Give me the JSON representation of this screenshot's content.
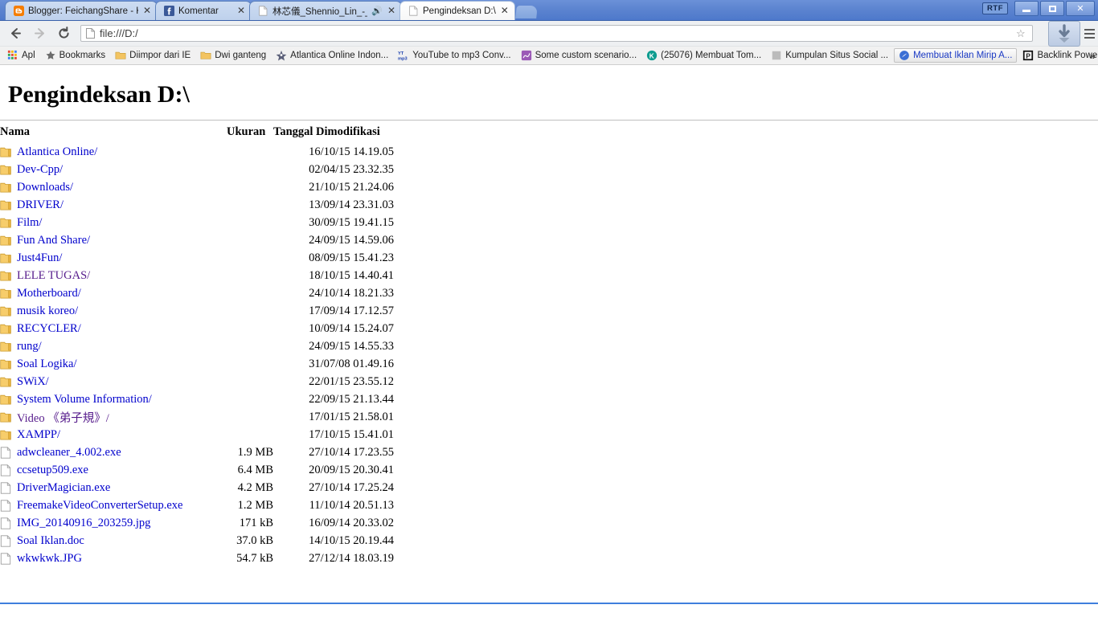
{
  "window": {
    "badge": "RTF",
    "minimize_label": "Minimize",
    "maximize_label": "Maximize",
    "close_label": "Close"
  },
  "tabs": [
    {
      "title": "Blogger: FeichangShare - Kn",
      "icon": "blogger-icon",
      "active": false,
      "audio": false
    },
    {
      "title": "Komentar",
      "icon": "facebook-icon",
      "active": false,
      "audio": false
    },
    {
      "title": "林芯儀_Shennio_Lin_-_",
      "icon": "page-icon",
      "active": false,
      "audio": true
    },
    {
      "title": "Pengindeksan D:\\",
      "icon": "page-icon",
      "active": true,
      "audio": false
    }
  ],
  "newtab_label": "New tab",
  "toolbar": {
    "back_label": "Back",
    "forward_label": "Forward",
    "reload_label": "Reload",
    "url": "file:///D:/",
    "bookmark_star_label": "Bookmark this page",
    "download_label": "Downloads",
    "menu_label": "Customize and control Google Chrome"
  },
  "bookmarks": {
    "overflow_label": "»",
    "items": [
      {
        "label": "Apl",
        "icon": "apps-grid-icon",
        "highlight": false
      },
      {
        "label": "Bookmarks",
        "icon": "star-icon",
        "highlight": false
      },
      {
        "label": "Diimpor dari IE",
        "icon": "folder-icon",
        "highlight": false
      },
      {
        "label": "Dwi ganteng",
        "icon": "folder-icon",
        "highlight": false
      },
      {
        "label": "Atlantica Online Indon...",
        "icon": "atlantica-icon",
        "highlight": false
      },
      {
        "label": "YouTube to mp3 Conv...",
        "icon": "youtube-mp3-icon",
        "highlight": false
      },
      {
        "label": "Some custom scenario...",
        "icon": "generic-site-icon",
        "highlight": false
      },
      {
        "label": "(25076) Membuat Tom...",
        "icon": "kaskus-icon",
        "highlight": false
      },
      {
        "label": "Kumpulan Situs Social ...",
        "icon": "blogger-icon",
        "highlight": false
      },
      {
        "label": "Membuat Iklan Mirip A...",
        "icon": "swirl-icon",
        "highlight": true
      },
      {
        "label": "Backlink Power",
        "icon": "p-badge-icon",
        "highlight": false
      }
    ]
  },
  "page": {
    "title": "Pengindeksan D:\\",
    "columns": {
      "name": "Nama",
      "size": "Ukuran",
      "date": "Tanggal Dimodifikasi"
    },
    "rows": [
      {
        "name": "Atlantica Online/",
        "size": "",
        "date": "16/10/15 14.19.05",
        "type": "folder",
        "visited": false
      },
      {
        "name": "Dev-Cpp/",
        "size": "",
        "date": "02/04/15 23.32.35",
        "type": "folder",
        "visited": false
      },
      {
        "name": "Downloads/",
        "size": "",
        "date": "21/10/15 21.24.06",
        "type": "folder",
        "visited": false
      },
      {
        "name": "DRIVER/",
        "size": "",
        "date": "13/09/14 23.31.03",
        "type": "folder",
        "visited": false
      },
      {
        "name": "Film/",
        "size": "",
        "date": "30/09/15 19.41.15",
        "type": "folder",
        "visited": false
      },
      {
        "name": "Fun And Share/",
        "size": "",
        "date": "24/09/15 14.59.06",
        "type": "folder",
        "visited": false
      },
      {
        "name": "Just4Fun/",
        "size": "",
        "date": "08/09/15 15.41.23",
        "type": "folder",
        "visited": false
      },
      {
        "name": "LELE TUGAS/",
        "size": "",
        "date": "18/10/15 14.40.41",
        "type": "folder",
        "visited": true
      },
      {
        "name": "Motherboard/",
        "size": "",
        "date": "24/10/14 18.21.33",
        "type": "folder",
        "visited": false
      },
      {
        "name": "musik koreo/",
        "size": "",
        "date": "17/09/14 17.12.57",
        "type": "folder",
        "visited": false
      },
      {
        "name": "RECYCLER/",
        "size": "",
        "date": "10/09/14 15.24.07",
        "type": "folder",
        "visited": false
      },
      {
        "name": "rung/",
        "size": "",
        "date": "24/09/15 14.55.33",
        "type": "folder",
        "visited": false
      },
      {
        "name": "Soal Logika/",
        "size": "",
        "date": "31/07/08 01.49.16",
        "type": "folder",
        "visited": false
      },
      {
        "name": "SWiX/",
        "size": "",
        "date": "22/01/15 23.55.12",
        "type": "folder",
        "visited": false
      },
      {
        "name": "System Volume Information/",
        "size": "",
        "date": "22/09/15 21.13.44",
        "type": "folder",
        "visited": false
      },
      {
        "name": "Video 《弟子規》/",
        "size": "",
        "date": "17/01/15 21.58.01",
        "type": "folder",
        "visited": true
      },
      {
        "name": "XAMPP/",
        "size": "",
        "date": "17/10/15 15.41.01",
        "type": "folder",
        "visited": false
      },
      {
        "name": "adwcleaner_4.002.exe",
        "size": "1.9 MB",
        "date": "27/10/14 17.23.55",
        "type": "file",
        "visited": false
      },
      {
        "name": "ccsetup509.exe",
        "size": "6.4 MB",
        "date": "20/09/15 20.30.41",
        "type": "file",
        "visited": false
      },
      {
        "name": "DriverMagician.exe",
        "size": "4.2 MB",
        "date": "27/10/14 17.25.24",
        "type": "file",
        "visited": false
      },
      {
        "name": "FreemakeVideoConverterSetup.exe",
        "size": "1.2 MB",
        "date": "11/10/14 20.51.13",
        "type": "file",
        "visited": false
      },
      {
        "name": "IMG_20140916_203259.jpg",
        "size": "171 kB",
        "date": "16/09/14 20.33.02",
        "type": "file",
        "visited": false
      },
      {
        "name": "Soal Iklan.doc",
        "size": "37.0 kB",
        "date": "14/10/15 20.19.44",
        "type": "file",
        "visited": false
      },
      {
        "name": "wkwkwk.JPG",
        "size": "54.7 kB",
        "date": "27/12/14 18.03.19",
        "type": "file",
        "visited": false
      }
    ]
  },
  "colors": {
    "link": "#0000cc",
    "visited_link": "#551a8b",
    "tabstrip_blue": "#5c84d0",
    "taskbar_blue": "#3f7fdd",
    "folder_gold": "#f5c451"
  }
}
